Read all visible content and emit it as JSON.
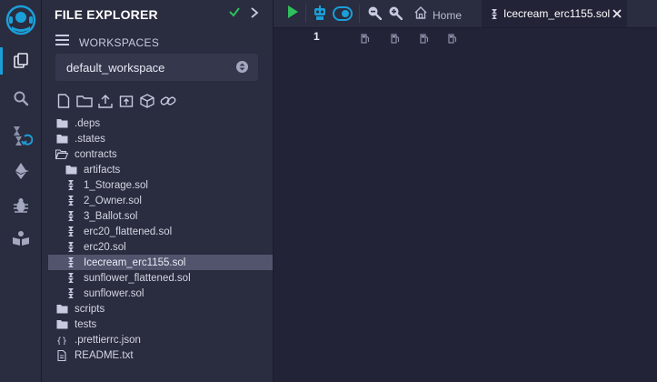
{
  "iconbar": {
    "items": [
      {
        "name": "remix-logo-icon"
      },
      {
        "name": "file-explorer-icon"
      },
      {
        "name": "search-icon"
      },
      {
        "name": "solidity-compiler-icon"
      },
      {
        "name": "deploy-run-icon"
      },
      {
        "name": "debugger-icon"
      },
      {
        "name": "learneth-icon"
      }
    ]
  },
  "panel": {
    "title": "FILE EXPLORER",
    "workspaces_label": "WORKSPACES",
    "workspace_selected": "default_workspace"
  },
  "tree": [
    {
      "label": ".deps",
      "type": "folder",
      "indent": 0
    },
    {
      "label": ".states",
      "type": "folder",
      "indent": 0
    },
    {
      "label": "contracts",
      "type": "folder-open",
      "indent": 0
    },
    {
      "label": "artifacts",
      "type": "folder",
      "indent": 1
    },
    {
      "label": "1_Storage.sol",
      "type": "sol",
      "indent": 1
    },
    {
      "label": "2_Owner.sol",
      "type": "sol",
      "indent": 1
    },
    {
      "label": "3_Ballot.sol",
      "type": "sol",
      "indent": 1
    },
    {
      "label": "erc20_flattened.sol",
      "type": "sol",
      "indent": 1
    },
    {
      "label": "erc20.sol",
      "type": "sol",
      "indent": 1
    },
    {
      "label": "Icecream_erc1155.sol",
      "type": "sol",
      "indent": 1,
      "selected": true
    },
    {
      "label": "sunflower_flattened.sol",
      "type": "sol",
      "indent": 1
    },
    {
      "label": "sunflower.sol",
      "type": "sol",
      "indent": 1
    },
    {
      "label": "scripts",
      "type": "folder",
      "indent": 0
    },
    {
      "label": "tests",
      "type": "folder",
      "indent": 0
    },
    {
      "label": ".prettierrc.json",
      "type": "json",
      "indent": 0
    },
    {
      "label": "README.txt",
      "type": "txt",
      "indent": 0
    }
  ],
  "topbar": {
    "home_label": "Home",
    "active_tab": "Icecream_erc1155.sol"
  },
  "editor": {
    "line_number": "1"
  },
  "colors": {
    "accent": "#1a9fd8",
    "run_green": "#2ec05c",
    "sidebar_bg": "#2a2c3f",
    "editor_bg": "#222336",
    "selected_row": "#51546c"
  }
}
